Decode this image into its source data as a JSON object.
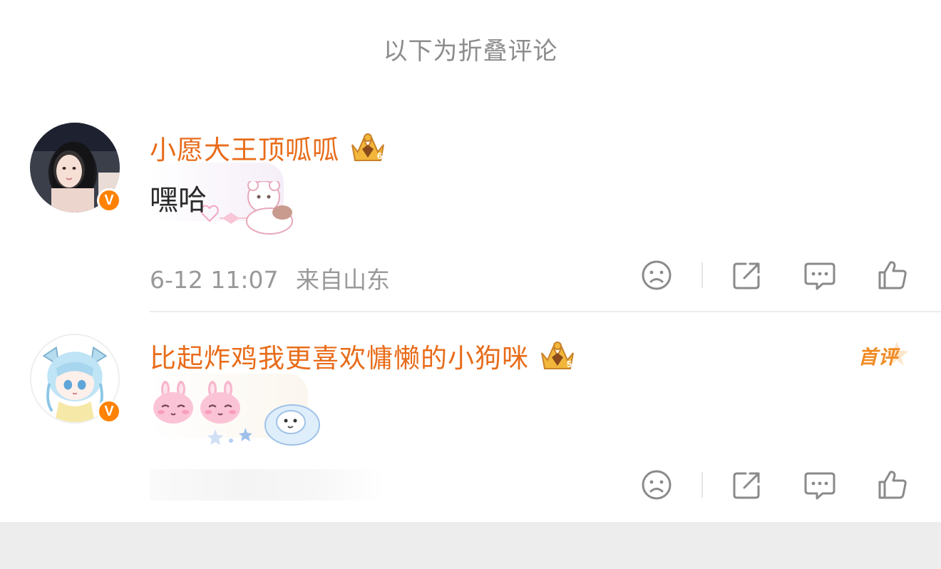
{
  "section": {
    "folded_label": "以下为折叠评论"
  },
  "comments": [
    {
      "username": "小愿大王顶呱呱",
      "text": "嘿哈",
      "verified_badge": "V",
      "crown_level": "6",
      "timestamp": "6-12 11:07",
      "location": "来自山东"
    },
    {
      "username": "比起炸鸡我更喜欢慵懒的小狗咪",
      "text": "",
      "verified_badge": "V",
      "crown_level": "5",
      "badge": "首评"
    }
  ],
  "icons": {
    "dislike": "sad-face-icon",
    "share": "share-icon",
    "comment": "comment-bubble-icon",
    "like": "thumbs-up-icon"
  },
  "colors": {
    "username": "#e86c1a",
    "verified": "#ff8200",
    "first_comment_badge": "#f08a22",
    "meta_text": "#999999"
  }
}
